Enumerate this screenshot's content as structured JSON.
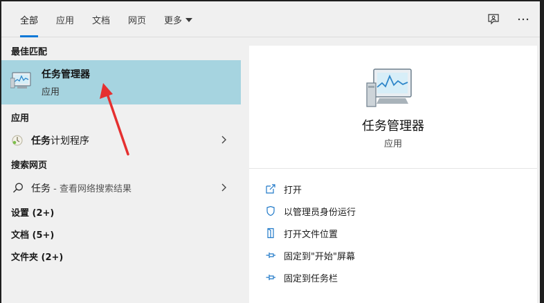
{
  "tabs": [
    {
      "label": "全部",
      "active": true
    },
    {
      "label": "应用"
    },
    {
      "label": "文档"
    },
    {
      "label": "网页"
    },
    {
      "label": "更多"
    }
  ],
  "top_icons": [
    "feedback-icon",
    "more-options-icon"
  ],
  "left": {
    "best_match_header": "最佳匹配",
    "best_match": {
      "title": "任务管理器",
      "subtitle": "应用",
      "icon": "task-manager-icon"
    },
    "apps_header": "应用",
    "apps": [
      {
        "label_bold": "任务",
        "label_rest": "计划程序",
        "icon": "task-scheduler-icon"
      }
    ],
    "web_header": "搜索网页",
    "web": [
      {
        "label": "任务",
        "suffix": " - 查看网络搜索结果",
        "icon": "search-icon"
      }
    ],
    "categories": [
      "设置 (2+)",
      "文档 (5+)",
      "文件夹 (2+)"
    ]
  },
  "preview": {
    "title": "任务管理器",
    "subtitle": "应用",
    "actions": [
      {
        "label": "打开",
        "icon": "open-icon"
      },
      {
        "label": "以管理员身份运行",
        "icon": "shield-icon"
      },
      {
        "label": "打开文件位置",
        "icon": "file-location-icon"
      },
      {
        "label": "固定到\"开始\"屏幕",
        "icon": "pin-icon"
      },
      {
        "label": "固定到任务栏",
        "icon": "pin-icon"
      }
    ]
  },
  "colors": {
    "accent": "#0a78d7",
    "selected_bg": "#a6d4e0",
    "annotation_arrow": "#e53030"
  }
}
